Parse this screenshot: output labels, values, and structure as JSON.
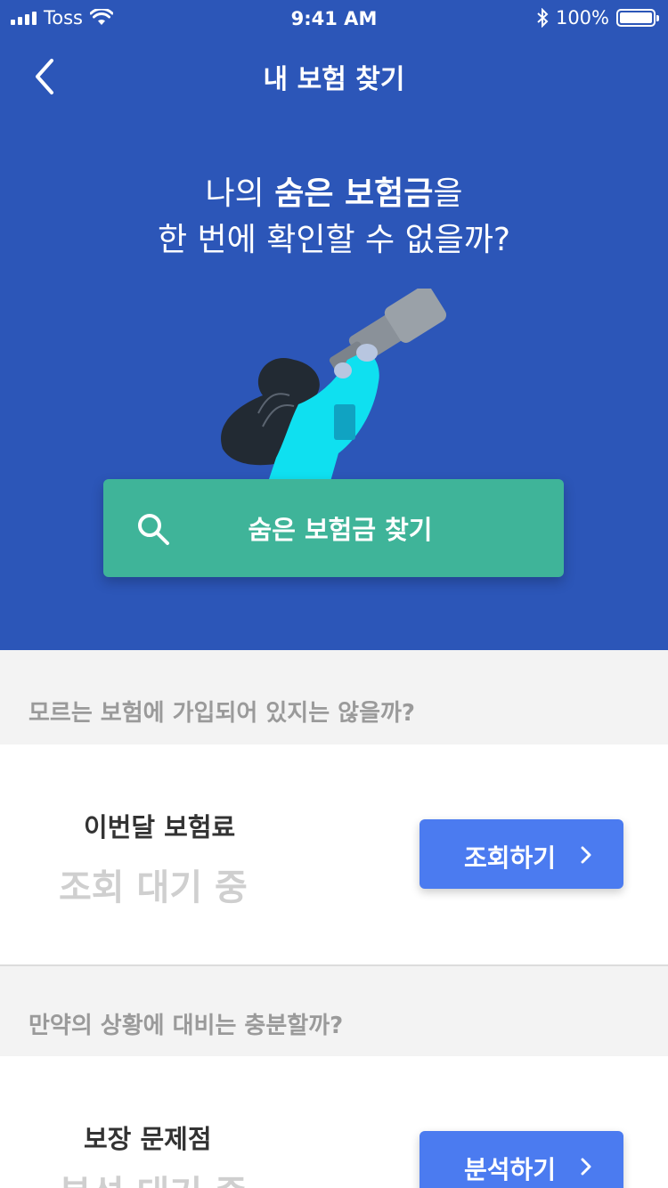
{
  "status_bar": {
    "carrier": "Toss",
    "time": "9:41 AM",
    "battery_pct": "100%",
    "battery_level": 1.0,
    "icons": [
      "signal-icon",
      "wifi-icon",
      "bluetooth-icon",
      "battery-icon"
    ]
  },
  "nav": {
    "title": "내 보험 찾기",
    "back_icon": "chevron-left-icon"
  },
  "hero": {
    "headline_pre": "나의 ",
    "headline_bold": "숨은 보험금",
    "headline_post": "을",
    "headline_line2": "한 번에 확인할 수 없을까?",
    "illustration": "person-with-telescope",
    "find_button": {
      "label": "숨은 보험금 찾기",
      "icon": "search-icon"
    }
  },
  "sections": [
    {
      "header": "모르는 보험에 가입되어 있지는 않을까?",
      "title": "이번달 보험료",
      "status": "조회 대기 중",
      "action_label": "조회하기",
      "action_icon": "chevron-right-icon"
    },
    {
      "header": "만약의 상황에 대비는 충분할까?",
      "title": "보장 문제점",
      "status": "분석 대기 중",
      "action_label": "분석하기",
      "action_icon": "chevron-right-icon"
    }
  ],
  "colors": {
    "hero_bg": "#2c56b8",
    "find_button": "#3fb499",
    "action_button": "#4b7bf0",
    "section_bg": "#f3f3f3",
    "muted_text": "#9a9a9a",
    "status_text": "#cfcfcf"
  }
}
